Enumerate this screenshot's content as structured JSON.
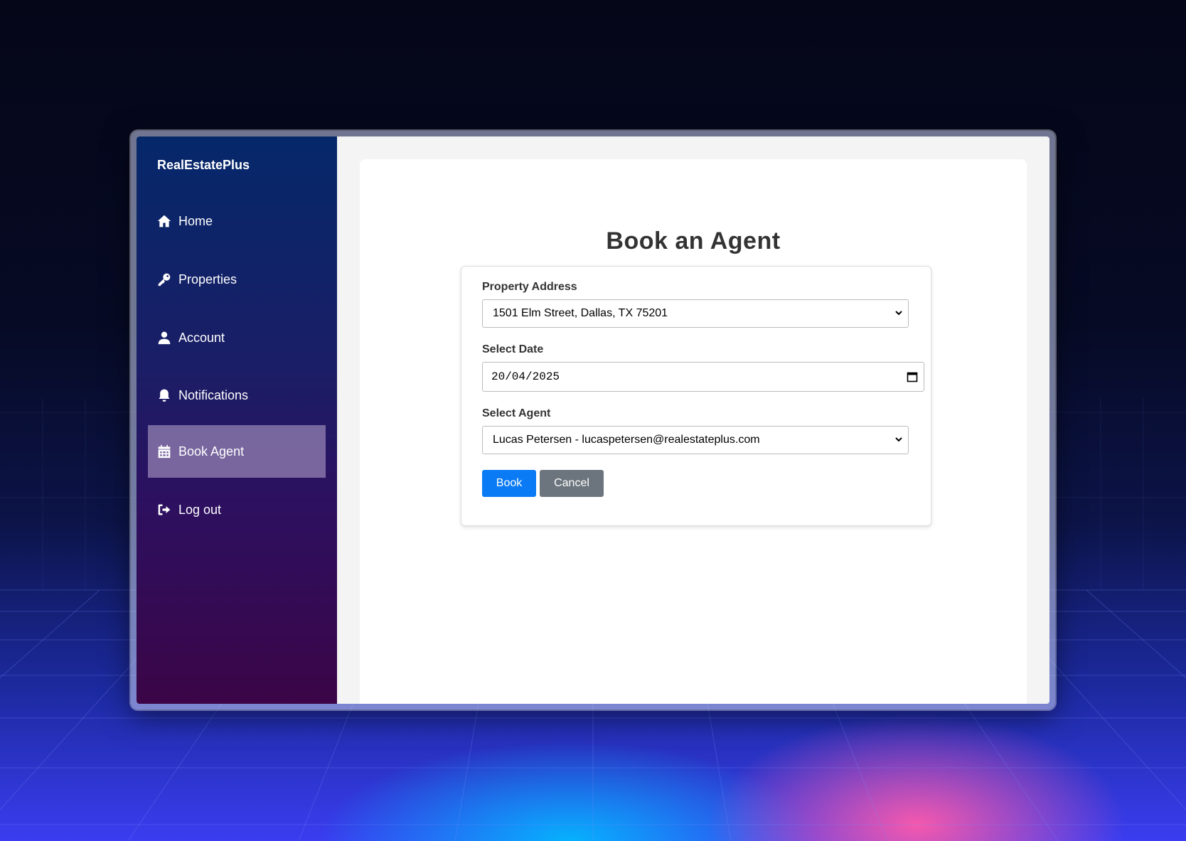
{
  "app": {
    "brand": "RealEstatePlus"
  },
  "sidebar": {
    "items": [
      {
        "label": "Home",
        "icon": "home-icon"
      },
      {
        "label": "Properties",
        "icon": "key-icon"
      },
      {
        "label": "Account",
        "icon": "user-icon"
      },
      {
        "label": "Notifications",
        "icon": "bell-icon"
      },
      {
        "label": "Book Agent",
        "icon": "calendar-icon",
        "active": true
      },
      {
        "label": "Log out",
        "icon": "logout-icon"
      }
    ]
  },
  "main": {
    "title": "Book an Agent",
    "form": {
      "address_label": "Property Address",
      "address_value": "1501 Elm Street, Dallas, TX 75201",
      "date_label": "Select Date",
      "date_value": "20/04/2025",
      "agent_label": "Select Agent",
      "agent_value": "Lucas Petersen - lucaspetersen@realestateplus.com",
      "book_label": "Book",
      "cancel_label": "Cancel"
    }
  },
  "colors": {
    "primary_button": "#0a7bf5",
    "secondary_button": "#6c757d",
    "sidebar_active": "#8a7198"
  }
}
